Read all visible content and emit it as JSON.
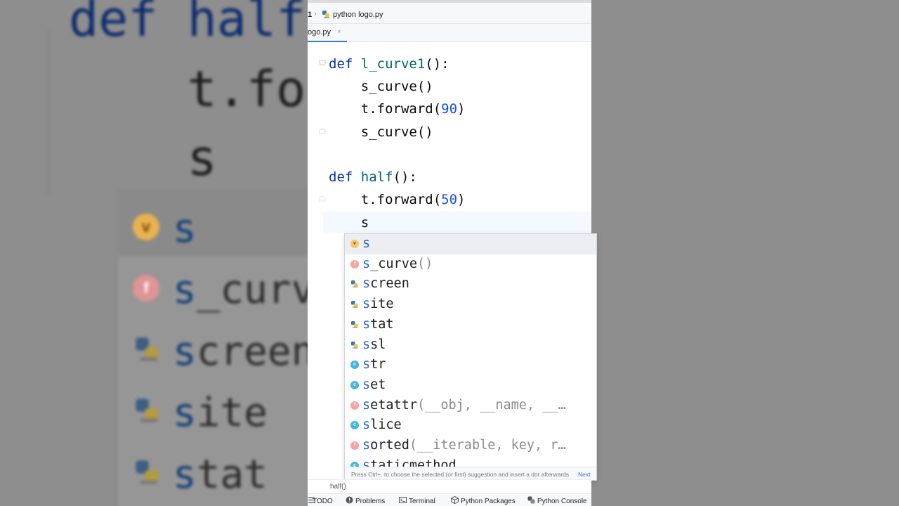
{
  "navigation": {
    "crumb_prefix": "1",
    "file_name": "python logo.py"
  },
  "tabs": [
    {
      "label": "ogo.py",
      "close": "×"
    }
  ],
  "editor": {
    "lines": [
      {
        "tokens": [
          {
            "t": "def ",
            "c": "kw"
          },
          {
            "t": "l_curve1",
            "c": "fn"
          },
          {
            "t": "():",
            "c": ""
          }
        ]
      },
      {
        "tokens": [
          {
            "t": "    s_curve()",
            "c": ""
          }
        ]
      },
      {
        "tokens": [
          {
            "t": "    t.forward(",
            "c": ""
          },
          {
            "t": "90",
            "c": "num"
          },
          {
            "t": ")",
            "c": ""
          }
        ]
      },
      {
        "tokens": [
          {
            "t": "    s_curve()",
            "c": ""
          }
        ]
      },
      {
        "tokens": [
          {
            "t": "",
            "c": ""
          }
        ]
      },
      {
        "tokens": [
          {
            "t": "def ",
            "c": "kw"
          },
          {
            "t": "half",
            "c": "fn"
          },
          {
            "t": "():",
            "c": ""
          }
        ]
      },
      {
        "tokens": [
          {
            "t": "    t.forward(",
            "c": ""
          },
          {
            "t": "50",
            "c": "num"
          },
          {
            "t": ")",
            "c": ""
          }
        ]
      },
      {
        "tokens": [
          {
            "t": "    s",
            "c": ""
          }
        ]
      }
    ]
  },
  "completion": {
    "items": [
      {
        "kind": "v",
        "badge": "v",
        "match": "s",
        "rest": "",
        "signature": "",
        "selected": true
      },
      {
        "kind": "f",
        "badge": "f",
        "match": "s",
        "rest": "_curve",
        "signature": "()",
        "selected": false
      },
      {
        "kind": "m",
        "badge": "",
        "match": "s",
        "rest": "creen",
        "signature": "",
        "selected": false
      },
      {
        "kind": "m",
        "badge": "",
        "match": "s",
        "rest": "ite",
        "signature": "",
        "selected": false
      },
      {
        "kind": "m",
        "badge": "",
        "match": "s",
        "rest": "tat",
        "signature": "",
        "selected": false
      },
      {
        "kind": "m",
        "badge": "",
        "match": "s",
        "rest": "sl",
        "signature": "",
        "selected": false
      },
      {
        "kind": "c",
        "badge": "c",
        "match": "s",
        "rest": "tr",
        "signature": "",
        "selected": false
      },
      {
        "kind": "c",
        "badge": "c",
        "match": "s",
        "rest": "et",
        "signature": "",
        "selected": false
      },
      {
        "kind": "f",
        "badge": "f",
        "match": "s",
        "rest": "etattr",
        "signature": "(__obj, __name, __…",
        "selected": false
      },
      {
        "kind": "c",
        "badge": "c",
        "match": "s",
        "rest": "lice",
        "signature": "",
        "selected": false
      },
      {
        "kind": "f",
        "badge": "f",
        "match": "s",
        "rest": "orted",
        "signature": "(__iterable, key, r…",
        "selected": false
      },
      {
        "kind": "c",
        "badge": "c",
        "match": "s",
        "rest": "taticmethod",
        "signature": "",
        "selected": false
      }
    ],
    "hint": "Press Ctrl+. to choose the selected (or first) suggestion and insert a dot afterwards",
    "hint_link": "Next"
  },
  "structure_crumb": "half()",
  "tool_windows": [
    {
      "label": "TODO",
      "icon": "todo-icon"
    },
    {
      "label": "Problems",
      "icon": "problems-icon"
    },
    {
      "label": "Terminal",
      "icon": "terminal-icon"
    },
    {
      "label": "Python Packages",
      "icon": "packages-icon"
    },
    {
      "label": "Python Console",
      "icon": "python-console-icon"
    }
  ],
  "backdrop": {
    "code_lines": [
      "def half(",
      "    t.for",
      "    s"
    ],
    "popup_items": [
      {
        "badge": "v",
        "match": "s",
        "rest": ""
      },
      {
        "badge": "f",
        "match": "s",
        "rest": "_curv"
      },
      {
        "badge": "",
        "match": "s",
        "rest": "creen"
      },
      {
        "badge": "",
        "match": "s",
        "rest": "ite"
      },
      {
        "badge": "",
        "match": "s",
        "rest": "tat"
      }
    ]
  }
}
